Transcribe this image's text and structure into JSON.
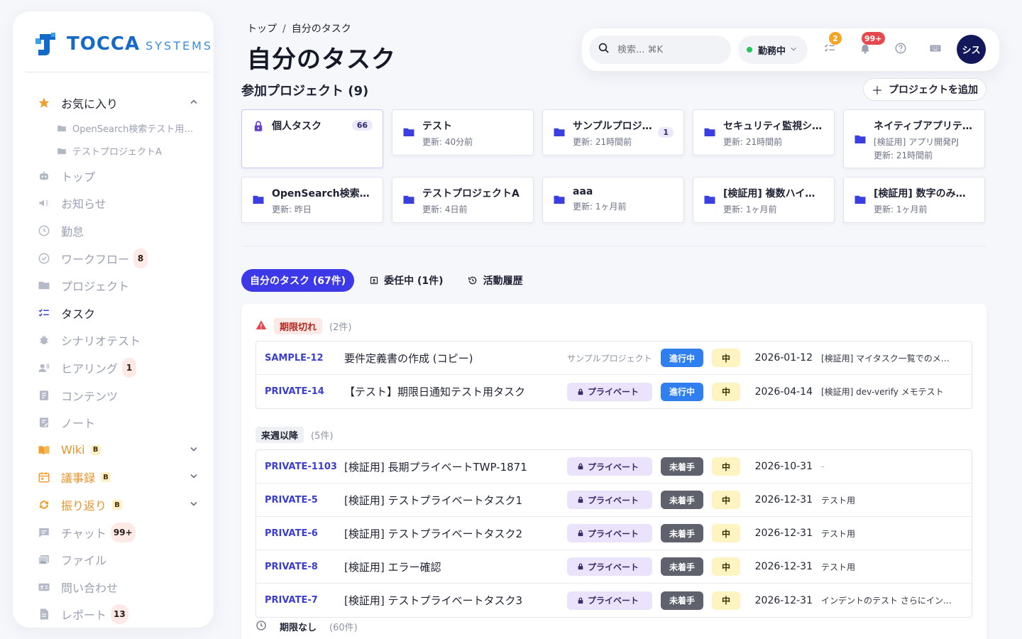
{
  "brand": {
    "name_strong": "TOCCA",
    "name_light": "SYSTEMS",
    "colors": {
      "primary": "#1569c7",
      "accent": "#3d38e8"
    }
  },
  "sidebar": {
    "favorites": {
      "label": "お気に入り",
      "icon": "star-icon",
      "items": [
        {
          "label": "OpenSearch検索テスト用プ…",
          "icon": "folder-icon"
        },
        {
          "label": "テストプロジェクトA",
          "icon": "folder-icon"
        }
      ]
    },
    "items": [
      {
        "label": "トップ",
        "icon": "robot-icon"
      },
      {
        "label": "お知らせ",
        "icon": "megaphone-icon"
      },
      {
        "label": "勤怠",
        "icon": "clock-icon"
      },
      {
        "label": "ワークフロー",
        "icon": "check-circle-icon",
        "badge": "8"
      },
      {
        "label": "プロジェクト",
        "icon": "folder-icon"
      },
      {
        "label": "タスク",
        "icon": "checklist-icon",
        "active": true
      },
      {
        "label": "シナリオテスト",
        "icon": "bug-icon"
      },
      {
        "label": "ヒアリング",
        "icon": "voice-icon",
        "badge": "1"
      },
      {
        "label": "コンテンツ",
        "icon": "document-icon"
      },
      {
        "label": "ノート",
        "icon": "note-icon"
      },
      {
        "label": "Wiki",
        "icon": "book-icon",
        "beta": "B",
        "expandable": true
      },
      {
        "label": "議事録",
        "icon": "calendar-icon",
        "beta": "B",
        "expandable": true
      },
      {
        "label": "振り返り",
        "icon": "refresh-icon",
        "beta": "B",
        "expandable": true
      },
      {
        "label": "チャット",
        "icon": "chat-icon",
        "badge": "99+"
      },
      {
        "label": "ファイル",
        "icon": "image-folder-icon"
      },
      {
        "label": "問い合わせ",
        "icon": "contact-card-icon"
      },
      {
        "label": "レポート",
        "icon": "report-icon",
        "badge": "13"
      }
    ]
  },
  "header": {
    "breadcrumb": [
      "トップ",
      "自分のタスク"
    ],
    "breadcrumb_sep": "/",
    "title": "自分のタスク"
  },
  "topbar": {
    "search_placeholder": "検索... ⌘K",
    "status_label": "勤務中",
    "tasks_badge": "2",
    "notifications_badge": "99+",
    "avatar_label": "シス"
  },
  "projects": {
    "title": "参加プロジェクト (9)",
    "add_label": "プロジェクトを追加",
    "cards": [
      {
        "name": "個人タスク",
        "sub": "",
        "sub2": "",
        "badge": "66",
        "icon": "lock-icon",
        "selected": true
      },
      {
        "name": "テスト",
        "sub": "更新: 40分前",
        "sub2": "",
        "badge": ""
      },
      {
        "name": "サンプルプロジェ…",
        "sub": "更新: 21時間前",
        "sub2": "",
        "badge": "1"
      },
      {
        "name": "セキュリティ監視シス…",
        "sub": "更新: 21時間前",
        "sub2": "",
        "badge": ""
      },
      {
        "name": "ネイティブアプリテス…",
        "sub": "[検証用] アプリ開発PJ",
        "sub2": "更新: 21時間前",
        "badge": ""
      },
      {
        "name": "OpenSearch検索テス…",
        "sub": "更新: 昨日",
        "sub2": "",
        "badge": ""
      },
      {
        "name": "テストプロジェクトA",
        "sub": "更新: 4日前",
        "sub2": "",
        "badge": ""
      },
      {
        "name": "aaa",
        "sub": "更新: 1ヶ月前",
        "sub2": "",
        "badge": ""
      },
      {
        "name": "[検証用] 複数ハイフン",
        "sub": "更新: 1ヶ月前",
        "sub2": "",
        "badge": ""
      },
      {
        "name": "[検証用] 数字のみコー…",
        "sub": "更新: 1ヶ月前",
        "sub2": "",
        "badge": ""
      }
    ]
  },
  "tabs": [
    {
      "label": "自分のタスク (67件)",
      "active": true
    },
    {
      "label": "委任中 (1件)",
      "icon": "delegate-icon"
    },
    {
      "label": "活動履歴",
      "icon": "history-icon"
    }
  ],
  "groups": {
    "overdue": {
      "label": "期限切れ",
      "count": "(2件)",
      "color": "#e5484d"
    },
    "next_week": {
      "label": "来週以降",
      "count": "(5件)"
    },
    "no_due": {
      "label": "期限なし",
      "count": "(60件)"
    }
  },
  "tasks_overdue": [
    {
      "id": "SAMPLE-12",
      "title": "要件定義書の作成 (コピー)",
      "project": "サンプルプロジェクト",
      "private": false,
      "status": "進行中",
      "status_kind": "prog",
      "priority": "中",
      "due": "2026-01-12",
      "memo": "[検証用] マイタスク一覧でのメモ…"
    },
    {
      "id": "PRIVATE-14",
      "title": "【テスト】期限日通知テスト用タスク",
      "project": "プライベート",
      "private": true,
      "status": "進行中",
      "status_kind": "prog",
      "priority": "中",
      "due": "2026-04-14",
      "memo": "[検証用] dev-verify メモテスト"
    }
  ],
  "tasks_next_week": [
    {
      "id": "PRIVATE-1103",
      "title": "[検証用] 長期プライベートTWP-1871",
      "project": "プライベート",
      "private": true,
      "status": "未着手",
      "status_kind": "todo",
      "priority": "中",
      "due": "2026-10-31",
      "memo": "-"
    },
    {
      "id": "PRIVATE-5",
      "title": "[検証用] テストプライベートタスク1",
      "project": "プライベート",
      "private": true,
      "status": "未着手",
      "status_kind": "todo",
      "priority": "中",
      "due": "2026-12-31",
      "memo": "テスト用"
    },
    {
      "id": "PRIVATE-6",
      "title": "[検証用] テストプライベートタスク2",
      "project": "プライベート",
      "private": true,
      "status": "未着手",
      "status_kind": "todo",
      "priority": "中",
      "due": "2026-12-31",
      "memo": "テスト用"
    },
    {
      "id": "PRIVATE-8",
      "title": "[検証用] エラー確認",
      "project": "プライベート",
      "private": true,
      "status": "未着手",
      "status_kind": "todo",
      "priority": "中",
      "due": "2026-12-31",
      "memo": "テスト用"
    },
    {
      "id": "PRIVATE-7",
      "title": "[検証用] テストプライベートタスク3",
      "project": "プライベート",
      "private": true,
      "status": "未着手",
      "status_kind": "todo",
      "priority": "中",
      "due": "2026-12-31",
      "memo": "インデントのテスト さらにインデ…"
    }
  ]
}
